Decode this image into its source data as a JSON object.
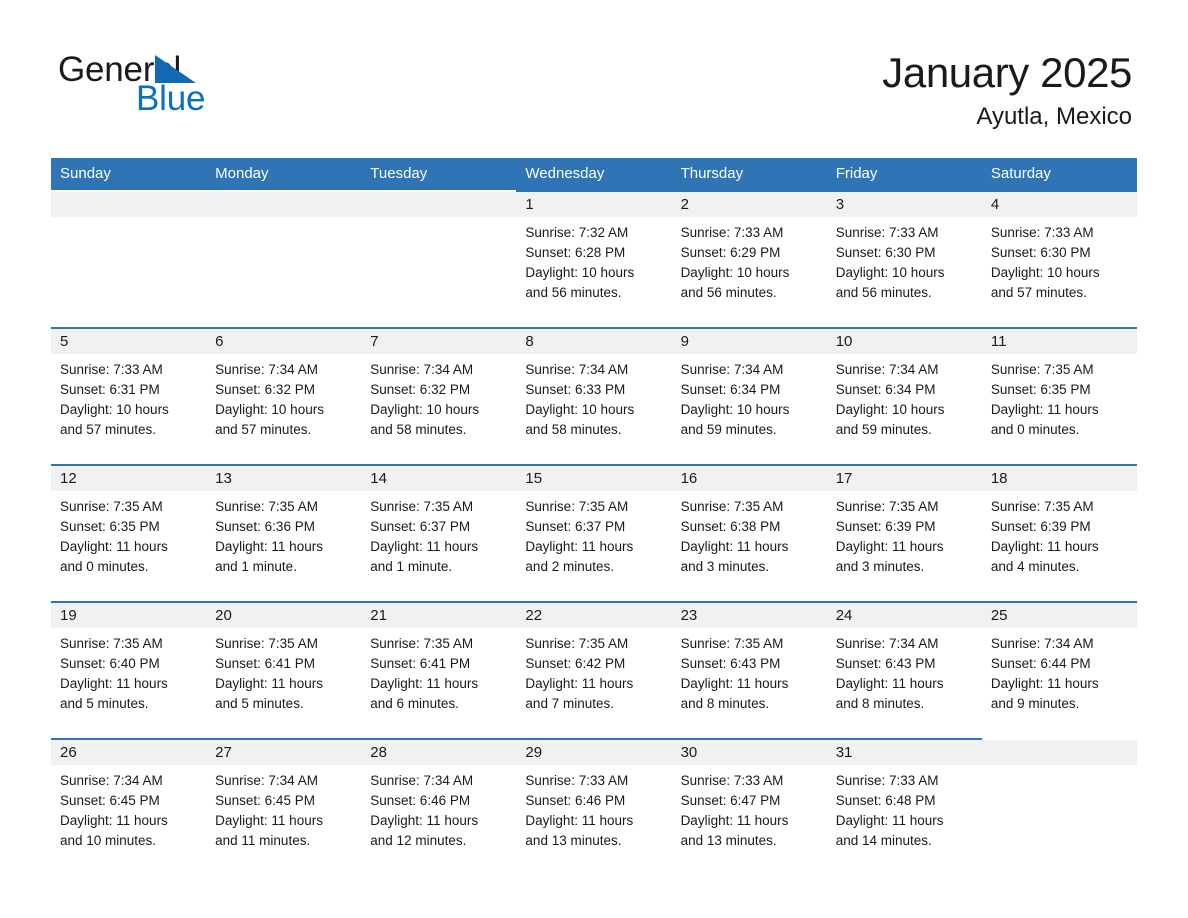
{
  "brand": {
    "name_part1": "General",
    "name_part2": "Blue",
    "triangle_color": "#1268b3",
    "blue_text_color": "#0b6fc4"
  },
  "header": {
    "title": "January 2025",
    "subtitle": "Ayutla, Mexico"
  },
  "theme": {
    "header_blue": "#2f75b5",
    "daynum_bg": "#f1f1f1",
    "text": "#1a1a1a"
  },
  "weekdays": [
    "Sunday",
    "Monday",
    "Tuesday",
    "Wednesday",
    "Thursday",
    "Friday",
    "Saturday"
  ],
  "labels": {
    "sunrise_prefix": "Sunrise:",
    "sunset_prefix": "Sunset:",
    "daylight_prefix": "Daylight:"
  },
  "weeks": [
    [
      {
        "day": "",
        "empty": true
      },
      {
        "day": "",
        "empty": true
      },
      {
        "day": "",
        "empty": true
      },
      {
        "day": "1",
        "sunrise": "Sunrise: 7:32 AM",
        "sunset": "Sunset: 6:28 PM",
        "daylight_l1": "Daylight: 10 hours",
        "daylight_l2": "and 56 minutes."
      },
      {
        "day": "2",
        "sunrise": "Sunrise: 7:33 AM",
        "sunset": "Sunset: 6:29 PM",
        "daylight_l1": "Daylight: 10 hours",
        "daylight_l2": "and 56 minutes."
      },
      {
        "day": "3",
        "sunrise": "Sunrise: 7:33 AM",
        "sunset": "Sunset: 6:30 PM",
        "daylight_l1": "Daylight: 10 hours",
        "daylight_l2": "and 56 minutes."
      },
      {
        "day": "4",
        "sunrise": "Sunrise: 7:33 AM",
        "sunset": "Sunset: 6:30 PM",
        "daylight_l1": "Daylight: 10 hours",
        "daylight_l2": "and 57 minutes."
      }
    ],
    [
      {
        "day": "5",
        "sunrise": "Sunrise: 7:33 AM",
        "sunset": "Sunset: 6:31 PM",
        "daylight_l1": "Daylight: 10 hours",
        "daylight_l2": "and 57 minutes."
      },
      {
        "day": "6",
        "sunrise": "Sunrise: 7:34 AM",
        "sunset": "Sunset: 6:32 PM",
        "daylight_l1": "Daylight: 10 hours",
        "daylight_l2": "and 57 minutes."
      },
      {
        "day": "7",
        "sunrise": "Sunrise: 7:34 AM",
        "sunset": "Sunset: 6:32 PM",
        "daylight_l1": "Daylight: 10 hours",
        "daylight_l2": "and 58 minutes."
      },
      {
        "day": "8",
        "sunrise": "Sunrise: 7:34 AM",
        "sunset": "Sunset: 6:33 PM",
        "daylight_l1": "Daylight: 10 hours",
        "daylight_l2": "and 58 minutes."
      },
      {
        "day": "9",
        "sunrise": "Sunrise: 7:34 AM",
        "sunset": "Sunset: 6:34 PM",
        "daylight_l1": "Daylight: 10 hours",
        "daylight_l2": "and 59 minutes."
      },
      {
        "day": "10",
        "sunrise": "Sunrise: 7:34 AM",
        "sunset": "Sunset: 6:34 PM",
        "daylight_l1": "Daylight: 10 hours",
        "daylight_l2": "and 59 minutes."
      },
      {
        "day": "11",
        "sunrise": "Sunrise: 7:35 AM",
        "sunset": "Sunset: 6:35 PM",
        "daylight_l1": "Daylight: 11 hours",
        "daylight_l2": "and 0 minutes."
      }
    ],
    [
      {
        "day": "12",
        "sunrise": "Sunrise: 7:35 AM",
        "sunset": "Sunset: 6:35 PM",
        "daylight_l1": "Daylight: 11 hours",
        "daylight_l2": "and 0 minutes."
      },
      {
        "day": "13",
        "sunrise": "Sunrise: 7:35 AM",
        "sunset": "Sunset: 6:36 PM",
        "daylight_l1": "Daylight: 11 hours",
        "daylight_l2": "and 1 minute."
      },
      {
        "day": "14",
        "sunrise": "Sunrise: 7:35 AM",
        "sunset": "Sunset: 6:37 PM",
        "daylight_l1": "Daylight: 11 hours",
        "daylight_l2": "and 1 minute."
      },
      {
        "day": "15",
        "sunrise": "Sunrise: 7:35 AM",
        "sunset": "Sunset: 6:37 PM",
        "daylight_l1": "Daylight: 11 hours",
        "daylight_l2": "and 2 minutes."
      },
      {
        "day": "16",
        "sunrise": "Sunrise: 7:35 AM",
        "sunset": "Sunset: 6:38 PM",
        "daylight_l1": "Daylight: 11 hours",
        "daylight_l2": "and 3 minutes."
      },
      {
        "day": "17",
        "sunrise": "Sunrise: 7:35 AM",
        "sunset": "Sunset: 6:39 PM",
        "daylight_l1": "Daylight: 11 hours",
        "daylight_l2": "and 3 minutes."
      },
      {
        "day": "18",
        "sunrise": "Sunrise: 7:35 AM",
        "sunset": "Sunset: 6:39 PM",
        "daylight_l1": "Daylight: 11 hours",
        "daylight_l2": "and 4 minutes."
      }
    ],
    [
      {
        "day": "19",
        "sunrise": "Sunrise: 7:35 AM",
        "sunset": "Sunset: 6:40 PM",
        "daylight_l1": "Daylight: 11 hours",
        "daylight_l2": "and 5 minutes."
      },
      {
        "day": "20",
        "sunrise": "Sunrise: 7:35 AM",
        "sunset": "Sunset: 6:41 PM",
        "daylight_l1": "Daylight: 11 hours",
        "daylight_l2": "and 5 minutes."
      },
      {
        "day": "21",
        "sunrise": "Sunrise: 7:35 AM",
        "sunset": "Sunset: 6:41 PM",
        "daylight_l1": "Daylight: 11 hours",
        "daylight_l2": "and 6 minutes."
      },
      {
        "day": "22",
        "sunrise": "Sunrise: 7:35 AM",
        "sunset": "Sunset: 6:42 PM",
        "daylight_l1": "Daylight: 11 hours",
        "daylight_l2": "and 7 minutes."
      },
      {
        "day": "23",
        "sunrise": "Sunrise: 7:35 AM",
        "sunset": "Sunset: 6:43 PM",
        "daylight_l1": "Daylight: 11 hours",
        "daylight_l2": "and 8 minutes."
      },
      {
        "day": "24",
        "sunrise": "Sunrise: 7:34 AM",
        "sunset": "Sunset: 6:43 PM",
        "daylight_l1": "Daylight: 11 hours",
        "daylight_l2": "and 8 minutes."
      },
      {
        "day": "25",
        "sunrise": "Sunrise: 7:34 AM",
        "sunset": "Sunset: 6:44 PM",
        "daylight_l1": "Daylight: 11 hours",
        "daylight_l2": "and 9 minutes."
      }
    ],
    [
      {
        "day": "26",
        "sunrise": "Sunrise: 7:34 AM",
        "sunset": "Sunset: 6:45 PM",
        "daylight_l1": "Daylight: 11 hours",
        "daylight_l2": "and 10 minutes."
      },
      {
        "day": "27",
        "sunrise": "Sunrise: 7:34 AM",
        "sunset": "Sunset: 6:45 PM",
        "daylight_l1": "Daylight: 11 hours",
        "daylight_l2": "and 11 minutes."
      },
      {
        "day": "28",
        "sunrise": "Sunrise: 7:34 AM",
        "sunset": "Sunset: 6:46 PM",
        "daylight_l1": "Daylight: 11 hours",
        "daylight_l2": "and 12 minutes."
      },
      {
        "day": "29",
        "sunrise": "Sunrise: 7:33 AM",
        "sunset": "Sunset: 6:46 PM",
        "daylight_l1": "Daylight: 11 hours",
        "daylight_l2": "and 13 minutes."
      },
      {
        "day": "30",
        "sunrise": "Sunrise: 7:33 AM",
        "sunset": "Sunset: 6:47 PM",
        "daylight_l1": "Daylight: 11 hours",
        "daylight_l2": "and 13 minutes."
      },
      {
        "day": "31",
        "sunrise": "Sunrise: 7:33 AM",
        "sunset": "Sunset: 6:48 PM",
        "daylight_l1": "Daylight: 11 hours",
        "daylight_l2": "and 14 minutes."
      },
      {
        "day": "",
        "empty": true
      }
    ]
  ]
}
